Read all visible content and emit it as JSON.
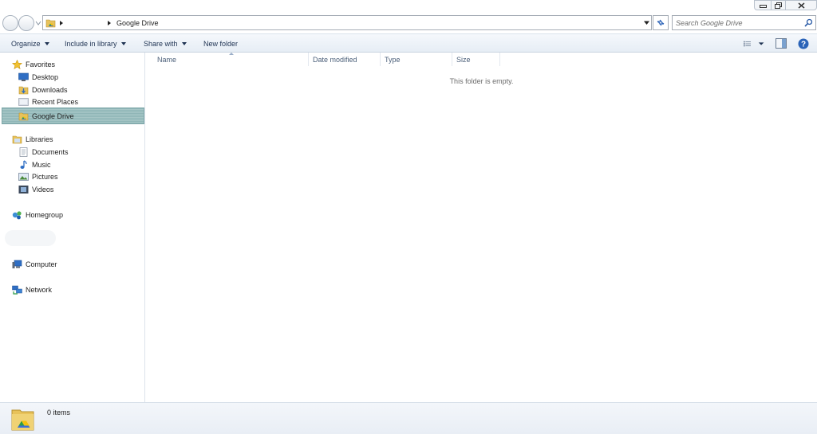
{
  "window": {
    "controls": {
      "minimize_icon": "minimize-icon",
      "restore_icon": "restore-icon",
      "close_icon": "close-icon"
    }
  },
  "address": {
    "breadcrumb": [
      "Google Drive"
    ],
    "search_placeholder": "Search Google Drive"
  },
  "toolbar": {
    "organize": "Organize",
    "include_in_library": "Include in library",
    "share_with": "Share with",
    "new_folder": "New folder"
  },
  "sidebar": {
    "favorites": {
      "label": "Favorites",
      "icon": "star-icon",
      "items": [
        {
          "label": "Desktop",
          "icon": "desktop-icon"
        },
        {
          "label": "Downloads",
          "icon": "downloads-folder-icon"
        },
        {
          "label": "Recent Places",
          "icon": "recent-places-icon"
        },
        {
          "label": "Google Drive",
          "icon": "google-drive-folder-icon",
          "selected": true
        }
      ]
    },
    "libraries": {
      "label": "Libraries",
      "icon": "libraries-icon",
      "items": [
        {
          "label": "Documents",
          "icon": "documents-icon"
        },
        {
          "label": "Music",
          "icon": "music-icon"
        },
        {
          "label": "Pictures",
          "icon": "pictures-icon"
        },
        {
          "label": "Videos",
          "icon": "videos-icon"
        }
      ]
    },
    "homegroup": {
      "label": "Homegroup",
      "icon": "homegroup-icon"
    },
    "computer": {
      "label": "Computer",
      "icon": "computer-icon"
    },
    "network": {
      "label": "Network",
      "icon": "network-icon"
    }
  },
  "content": {
    "columns": [
      "Name",
      "Date modified",
      "Type",
      "Size"
    ],
    "empty_message": "This folder is empty."
  },
  "details": {
    "count_text": "0 items"
  },
  "colors": {
    "selection": "#9dbfc0",
    "command_bar": "#e9eff6",
    "header_text": "#4c607a",
    "accent_blue": "#1e3252"
  }
}
